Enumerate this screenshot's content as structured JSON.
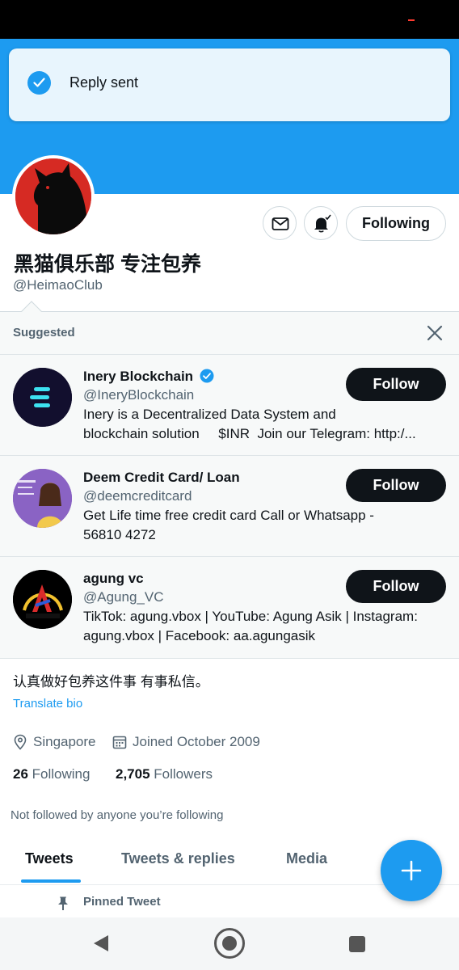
{
  "toast": {
    "text": "Reply sent",
    "icon": "check-icon"
  },
  "profile": {
    "display_name": "黑猫俱乐部 专注包养",
    "handle": "@HeimaoClub",
    "following_label": "Following",
    "bio": "认真做好包养这件事 有事私信。",
    "translate_label": "Translate bio",
    "location": "Singapore",
    "joined": "Joined October 2009",
    "following_count": "26",
    "following_label_stat": "Following",
    "followers_count": "2,705",
    "followers_label": "Followers",
    "not_followed": "Not followed by anyone you’re following"
  },
  "suggested": {
    "title": "Suggested",
    "accounts": [
      {
        "name": "Inery Blockchain",
        "verified": true,
        "handle": "@IneryBlockchain",
        "bio": "Inery is a Decentralized Data System and\nblockchain solution     $INR  Join our Telegram: http:/...",
        "follow_label": "Follow"
      },
      {
        "name": "Deem Credit Card/ Loan",
        "verified": false,
        "handle": "@deemcreditcard",
        "bio": "Get Life time free credit card Call or Whatsapp -\n56810 4272",
        "follow_label": "Follow"
      },
      {
        "name": "agung vc",
        "verified": false,
        "handle": "@Agung_VC",
        "bio": "TikTok: agung.vbox | YouTube: Agung Asik | Instagram:\nagung.vbox | Facebook: aa.agungasik",
        "follow_label": "Follow"
      }
    ]
  },
  "tabs": [
    {
      "label": "Tweets",
      "active": true
    },
    {
      "label": "Tweets & replies",
      "active": false
    },
    {
      "label": "Media",
      "active": false
    }
  ],
  "pinned_label": "Pinned Tweet",
  "colors": {
    "accent": "#1d9bf0",
    "text": "#0f1419",
    "secondary": "#536471"
  }
}
